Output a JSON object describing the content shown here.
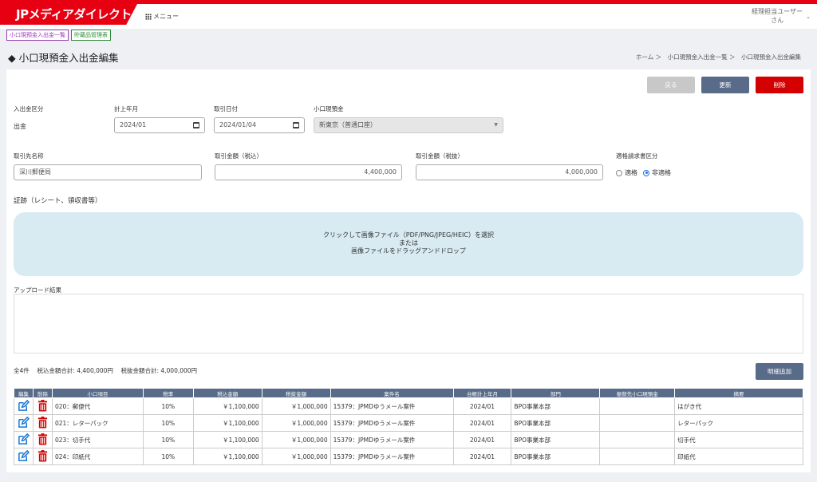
{
  "app": {
    "logo": "JPメディアダイレクト",
    "menu_label": "メニュー",
    "user_line1": "経理担当ユーザー",
    "user_line2": "さん"
  },
  "tabs": [
    "小口現預金入出金一覧",
    "貯蔵品管理表"
  ],
  "page": {
    "title": "小口現預金入出金編集",
    "breadcrumb": "ホーム ＞　小口現預金入出金一覧 ＞　小口現預金入出金編集"
  },
  "actions": {
    "back": "戻る",
    "update": "更新",
    "delete": "削除"
  },
  "form": {
    "kubun_label": "入出金区分",
    "kubun_value": "出金",
    "keijo_label": "計上年月",
    "keijo_value": "2024/01",
    "torihikibi_label": "取引日付",
    "torihikibi_value": "2024/01/04",
    "koguchi_label": "小口現預金",
    "koguchi_value": "新東京（普通口座）",
    "saki_label": "取引先名称",
    "saki_value": "深川郵便局",
    "zeikomi_label": "取引金額（税込）",
    "zeikomi_value": "4,400,000",
    "zeinuki_label": "取引金額（税抜）",
    "zeinuki_value": "4,000,000",
    "tekikaku_label": "適格請求書区分",
    "tekikaku_options": [
      "適格",
      "非適格"
    ],
    "tekikaku_selected": "非適格"
  },
  "evidence": {
    "title": "証跡（レシート、領収書等）",
    "drop_line1": "クリックして画像ファイル（PDF/PNG/JPEG/HEIC）を選択",
    "drop_line2": "または",
    "drop_line3": "画像ファイルをドラッグアンドドロップ",
    "upload_result_label": "アップロード結果"
  },
  "summary": {
    "count": "全4件",
    "zeikomi_total": "税込金額合計: 4,400,000円",
    "zeinuki_total": "税抜金額合計: 4,000,000円",
    "add_button": "明細追加"
  },
  "table": {
    "headers": [
      "編集",
      "削除",
      "小口項目",
      "税率",
      "税込金額",
      "税抜金額",
      "案件名",
      "台帳計上年月",
      "部門",
      "振替先小口現預金",
      "摘要"
    ],
    "rows": [
      {
        "item": "020：郵便代",
        "rate": "10%",
        "zeikomi": "￥1,100,000",
        "zeinuki": "￥1,000,000",
        "project": "15379：JPMDゆうメール案件",
        "month": "2024/01",
        "dept": "BPO事業本部",
        "transfer": "",
        "memo": "はがき代"
      },
      {
        "item": "021：レターパック",
        "rate": "10%",
        "zeikomi": "￥1,100,000",
        "zeinuki": "￥1,000,000",
        "project": "15379：JPMDゆうメール案件",
        "month": "2024/01",
        "dept": "BPO事業本部",
        "transfer": "",
        "memo": "レターパック"
      },
      {
        "item": "023：切手代",
        "rate": "10%",
        "zeikomi": "￥1,100,000",
        "zeinuki": "￥1,000,000",
        "project": "15379：JPMDゆうメール案件",
        "month": "2024/01",
        "dept": "BPO事業本部",
        "transfer": "",
        "memo": "切手代"
      },
      {
        "item": "024：印紙代",
        "rate": "10%",
        "zeikomi": "￥1,100,000",
        "zeinuki": "￥1,000,000",
        "project": "15379：JPMDゆうメール案件",
        "month": "2024/01",
        "dept": "BPO事業本部",
        "transfer": "",
        "memo": "印紙代"
      }
    ]
  },
  "colors": {
    "brand": "#e60012",
    "primary_button": "#586b88",
    "delete_button": "#d50000",
    "disabled_button": "#c8c8c8",
    "dropzone": "#d8eaf2"
  },
  "icons": {
    "menu": "grid-icon",
    "edit": "edit-icon",
    "delete": "trash-icon",
    "date": "calendar-icon",
    "user": "chevron-down-icon"
  }
}
